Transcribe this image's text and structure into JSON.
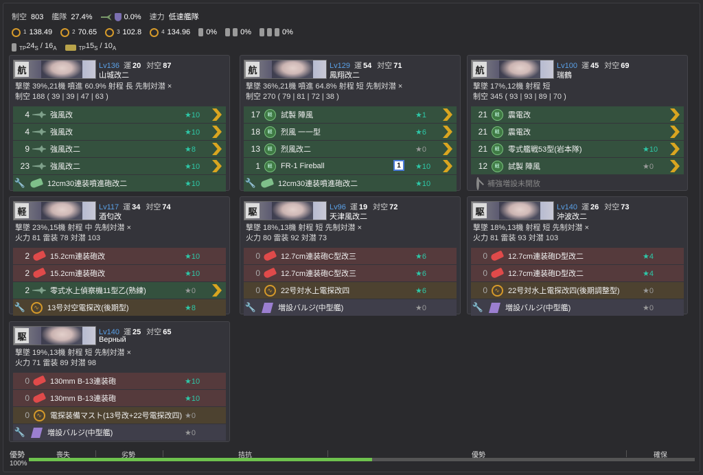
{
  "summary": {
    "air_label": "制空",
    "air_value": "803",
    "tank_label": "艦隊",
    "tank_value": "27.4%",
    "ship_pct": "0.0%",
    "speed_label": "速力",
    "speed_value": "低速艦隊",
    "los": [
      "138.49",
      "70.65",
      "102.8",
      "134.96"
    ],
    "los_sub": [
      "1",
      "2",
      "3",
      "4"
    ],
    "drum_pct": "0%",
    "daihatsu_pct": "0%",
    "multi_pct": "0%",
    "tp_s": "24",
    "tp_a": "16",
    "tp2_s": "15",
    "tp2_a": "10",
    "tp_prefix": "TP",
    "sub_s": "S",
    "sub_a": "A",
    "sep": "/"
  },
  "ships": [
    {
      "class_char": "航",
      "lv": "Lv136",
      "luck_label": "運",
      "luck": "20",
      "aa_label": "対空",
      "aa": "87",
      "name": "山城改二",
      "line1": "撃墜 39%,21機  噴進 60.9%  射程 長  先制対潜 ×",
      "line2": "制空 188 ( 39 | 39 | 47 | 63 )",
      "slots": [
        {
          "count": "4",
          "name": "強風改",
          "star": "★10",
          "kind": "g"
        },
        {
          "count": "4",
          "name": "強風改",
          "star": "★10",
          "kind": "g"
        },
        {
          "count": "9",
          "name": "強風改二",
          "star": "★8",
          "kind": "g"
        },
        {
          "count": "23",
          "name": "強風改二",
          "star": "★10",
          "kind": "g"
        }
      ],
      "ex": {
        "name": "12cm30連装噴進砲改二",
        "star": "★10"
      }
    },
    {
      "class_char": "航",
      "lv": "Lv129",
      "luck_label": "運",
      "luck": "54",
      "aa_label": "対空",
      "aa": "71",
      "name": "鳳翔改二",
      "line1": "撃墜 36%,21機  噴進 64.8%  射程 短  先制対潜 ×",
      "line2": "制空 270 ( 79 | 81 | 72 | 38 )",
      "slots": [
        {
          "count": "17",
          "name": "試製 陣風",
          "star": "★1",
          "kind": "g"
        },
        {
          "count": "18",
          "name": "烈風 一一型",
          "star": "★6",
          "kind": "g"
        },
        {
          "count": "13",
          "name": "烈風改二",
          "star": "★0",
          "kind": "g"
        },
        {
          "count": "1",
          "name": "FR-1 Fireball",
          "star": "★10",
          "kind": "g",
          "badge": "1"
        }
      ],
      "ex": {
        "name": "12cm30連装噴進砲改二",
        "star": "★10"
      }
    },
    {
      "class_char": "航",
      "lv": "Lv100",
      "luck_label": "運",
      "luck": "45",
      "aa_label": "対空",
      "aa": "69",
      "name": "瑞鶴",
      "line1": "撃墜 17%,12機  射程 短",
      "line2": "制空 345 ( 93 | 93 | 89 | 70 )",
      "slots": [
        {
          "count": "21",
          "name": "震電改",
          "star": "",
          "kind": "g"
        },
        {
          "count": "21",
          "name": "震電改",
          "star": "",
          "kind": "g"
        },
        {
          "count": "21",
          "name": "零式艦戦53型(岩本隊)",
          "star": "★10",
          "kind": "g"
        },
        {
          "count": "12",
          "name": "試製 陣風",
          "star": "★0",
          "kind": "g"
        }
      ],
      "ex": {
        "name": "補強増設未開放",
        "star": ""
      }
    },
    {
      "class_char": "軽",
      "lv": "Lv117",
      "luck_label": "運",
      "luck": "34",
      "aa_label": "対空",
      "aa": "74",
      "name": "酒匂改",
      "line1": "撃墜 23%,15機  射程 中  先制対潜 ×",
      "line2": "火力 81  雷装 78  対潜 103",
      "slots": [
        {
          "count": "2",
          "name": "15.2cm連装砲改",
          "star": "★10",
          "kind": "r"
        },
        {
          "count": "2",
          "name": "15.2cm連装砲改",
          "star": "★10",
          "kind": "r"
        },
        {
          "count": "2",
          "name": "零式水上偵察機11型乙(熟練)",
          "star": "★0",
          "kind": "g"
        }
      ],
      "ex": {
        "name": "13号対空電探改(後期型)",
        "star": "★8"
      }
    },
    {
      "class_char": "駆",
      "lv": "Lv96",
      "luck_label": "運",
      "luck": "19",
      "aa_label": "対空",
      "aa": "72",
      "name": "天津風改二",
      "line1": "撃墜 18%,13機  射程 短  先制対潜 ×",
      "line2": "火力 80  雷装 92  対潜 73",
      "slots": [
        {
          "count": "0",
          "name": "12.7cm連装砲C型改三",
          "star": "★6",
          "kind": "r"
        },
        {
          "count": "0",
          "name": "12.7cm連装砲C型改三",
          "star": "★6",
          "kind": "r"
        },
        {
          "count": "0",
          "name": "22号対水上電探改四",
          "star": "★6",
          "kind": "y"
        }
      ],
      "ex": {
        "name": "増設バルジ(中型艦)",
        "star": "★0"
      }
    },
    {
      "class_char": "駆",
      "lv": "Lv140",
      "luck_label": "運",
      "luck": "26",
      "aa_label": "対空",
      "aa": "73",
      "name": "沖波改二",
      "line1": "撃墜 18%,13機  射程 短  先制対潜 ×",
      "line2": "火力 81  雷装 93  対潜 103",
      "slots": [
        {
          "count": "0",
          "name": "12.7cm連装砲D型改二",
          "star": "★4",
          "kind": "r"
        },
        {
          "count": "0",
          "name": "12.7cm連装砲D型改二",
          "star": "★4",
          "kind": "r"
        },
        {
          "count": "0",
          "name": "22号対水上電探改四(後期調整型)",
          "star": "★0",
          "kind": "y"
        }
      ],
      "ex": {
        "name": "増設バルジ(中型艦)",
        "star": "★0"
      }
    },
    {
      "class_char": "駆",
      "lv": "Lv140",
      "luck_label": "運",
      "luck": "25",
      "aa_label": "対空",
      "aa": "65",
      "name": "Верный",
      "line1": "撃墜 19%,13機  射程 短  先制対潜 ×",
      "line2": "火力 71  雷装 89  対潜 98",
      "slots": [
        {
          "count": "0",
          "name": "130mm B-13連装砲",
          "star": "★10",
          "kind": "r"
        },
        {
          "count": "0",
          "name": "130mm B-13連装砲",
          "star": "★10",
          "kind": "r"
        },
        {
          "count": "0",
          "name": "電探装備マスト(13号改+22号電探改四)",
          "star": "★0",
          "kind": "y"
        }
      ],
      "ex": {
        "name": "増設バルジ(中型艦)",
        "star": "★0"
      }
    }
  ],
  "air_state": {
    "label": "優勢",
    "pct": "100%",
    "fill": 0.515,
    "scale": [
      "喪失",
      "劣勢",
      "拮抗",
      "優勢",
      "確保"
    ]
  }
}
